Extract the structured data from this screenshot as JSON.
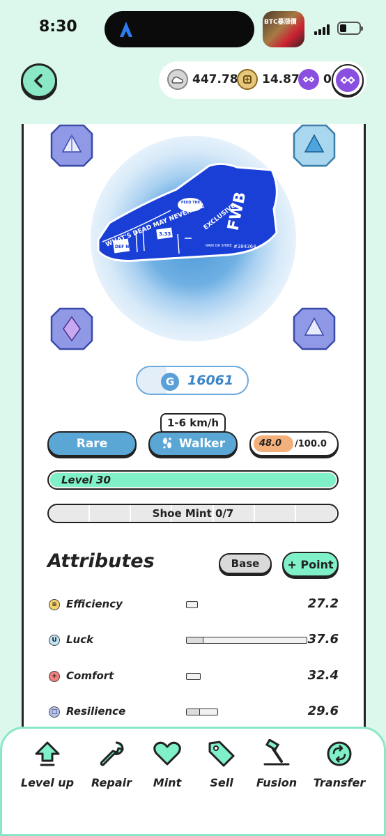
{
  "status_bar": {
    "time": "8:30",
    "pip_text": "BTC暴漲價"
  },
  "wallet": {
    "gst": "447.78",
    "gmt": "14.87",
    "pol": "0"
  },
  "sneaker": {
    "brand": "FWB",
    "tagline": "WHAT'S DEAD MAY NEVER DIE",
    "badge": "EXCLUSIVE",
    "serial": "#384364",
    "tag1": "FEED THE PIGS",
    "tag2": "RAIN OR SHINE",
    "sticker1": "DEF NYC",
    "sticker2": "3.33"
  },
  "gem_count": {
    "icon": "G",
    "value": "16061"
  },
  "speed_range": "1-6 km/h",
  "quality": "Rare",
  "type": "Walker",
  "durability": {
    "current": "48.0",
    "max": "/100.0",
    "fraction": 0.48
  },
  "level": {
    "label": "Level 30",
    "fraction": 1.0
  },
  "shoe_mint": {
    "label": "Shoe Mint 0/7"
  },
  "attributes_title": "Attributes",
  "buttons": {
    "base": "Base",
    "point": "+ Point"
  },
  "attributes": [
    {
      "name": "Efficiency",
      "value": "27.2",
      "color": "#f6d36a",
      "fill": 0.1
    },
    {
      "name": "Luck",
      "value": "37.6",
      "color": "#bfe6f6",
      "fill": 0.15
    },
    {
      "name": "Comfort",
      "value": "32.4",
      "color": "#f27d7d",
      "fill": 0.1
    },
    {
      "name": "Resilience",
      "value": "29.6",
      "color": "#b6c3f2",
      "fill": 0.4
    }
  ],
  "toolbar": {
    "level_up": "Level up",
    "repair": "Repair",
    "mint": "Mint",
    "sell": "Sell",
    "fusion": "Fusion",
    "transfer": "Transfer"
  },
  "colors": {
    "accent": "#7ff0c8",
    "blue": "#5aa7d6",
    "polygon": "#8b4fe0"
  }
}
